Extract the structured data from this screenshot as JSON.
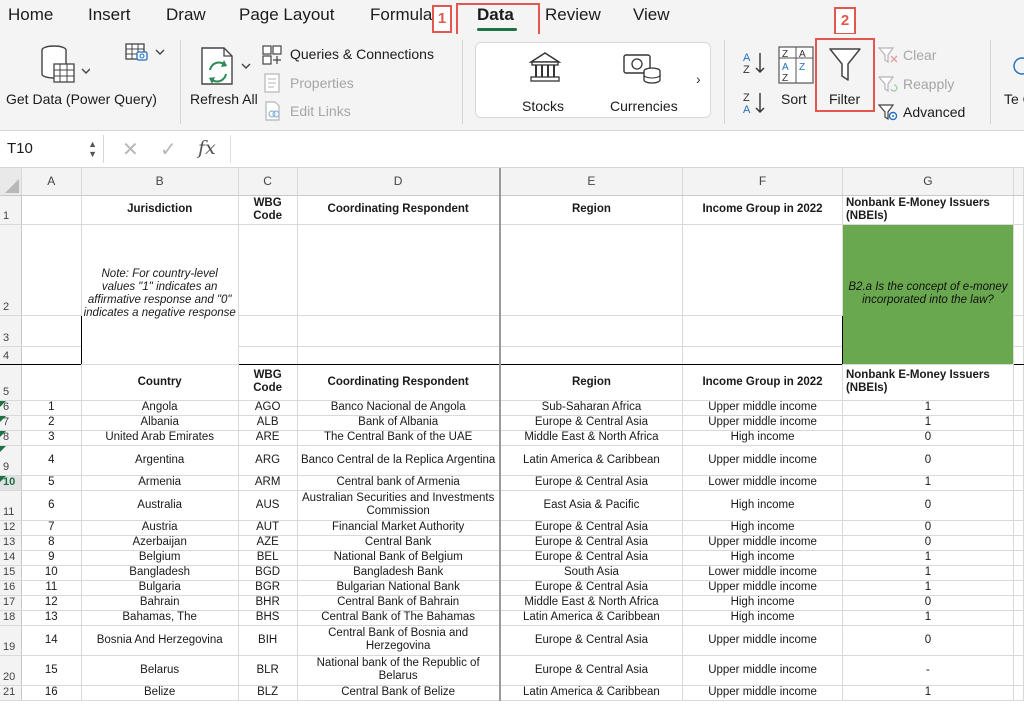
{
  "tabs": [
    {
      "label": "Home"
    },
    {
      "label": "Insert"
    },
    {
      "label": "Draw"
    },
    {
      "label": "Page Layout"
    },
    {
      "label": "Formulas"
    },
    {
      "label": "Data"
    },
    {
      "label": "Review"
    },
    {
      "label": "View"
    }
  ],
  "callouts": {
    "one": "1",
    "two": "2"
  },
  "ribbon": {
    "get_data": "Get Data (Power Query)",
    "refresh_all": "Refresh All",
    "queries_connections": "Queries & Connections",
    "properties": "Properties",
    "edit_links": "Edit Links",
    "stocks": "Stocks",
    "currencies": "Currencies",
    "sort": "Sort",
    "filter": "Filter",
    "clear": "Clear",
    "reapply": "Reapply",
    "advanced": "Advanced",
    "text_to_columns_partial": "Te Co"
  },
  "formula_bar": {
    "name_box": "T10",
    "cancel": "✕",
    "enter": "✓",
    "fx": "fx",
    "value": ""
  },
  "colors": {
    "accent": "#1e7145",
    "callout": "#e4574c",
    "highlight": "#6aa84f"
  },
  "sheet": {
    "columns": [
      "A",
      "B",
      "C",
      "D",
      "E",
      "F",
      "G"
    ],
    "header1": {
      "b": "Jurisdiction",
      "c": "WBG Code",
      "d": "Coordinating Respondent",
      "e": "Region",
      "f": "Income Group in 2022",
      "g": "Nonbank E-Money Issuers (NBEIs)"
    },
    "note": "Note: For country-level values \"1\" indicates an affirmative response and \"0\" indicates a negative response",
    "question": "B2.a Is the concept of e-money incorporated into the law?",
    "header5": {
      "b": "Country",
      "c": "WBG Code",
      "d": "Coordinating Respondent",
      "e": "Region",
      "f": "Income Group in 2022",
      "g": "Nonbank E-Money Issuers (NBEIs)"
    },
    "row_numbers": [
      "1",
      "2",
      "3",
      "4",
      "5"
    ],
    "rows": [
      {
        "r": "6",
        "a": "1",
        "b": "Angola",
        "c": "AGO",
        "d": "Banco Nacional de Angola",
        "e": "Sub-Saharan Africa",
        "f": "Upper middle income",
        "g": "1"
      },
      {
        "r": "7",
        "a": "2",
        "b": "Albania",
        "c": "ALB",
        "d": "Bank of Albania",
        "e": "Europe & Central Asia",
        "f": "Upper middle income",
        "g": "1"
      },
      {
        "r": "8",
        "a": "3",
        "b": "United Arab Emirates",
        "c": "ARE",
        "d": "The Central Bank of the UAE",
        "e": "Middle East & North Africa",
        "f": "High income",
        "g": "0"
      },
      {
        "r": "9",
        "a": "4",
        "b": "Argentina",
        "c": "ARG",
        "d": "Banco Central de la Replica Argentina",
        "e": "Latin America & Caribbean",
        "f": "Upper middle income",
        "g": "0"
      },
      {
        "r": "10",
        "a": "5",
        "b": "Armenia",
        "c": "ARM",
        "d": "Central bank of Armenia",
        "e": "Europe & Central Asia",
        "f": "Lower middle income",
        "g": "1"
      },
      {
        "r": "11",
        "a": "6",
        "b": "Australia",
        "c": "AUS",
        "d": "Australian Securities and Investments Commission",
        "e": "East Asia & Pacific",
        "f": "High income",
        "g": "0"
      },
      {
        "r": "12",
        "a": "7",
        "b": "Austria",
        "c": "AUT",
        "d": "Financial Market Authority",
        "e": "Europe & Central Asia",
        "f": "High income",
        "g": "0"
      },
      {
        "r": "13",
        "a": "8",
        "b": "Azerbaijan",
        "c": "AZE",
        "d": "Central Bank",
        "e": "Europe & Central Asia",
        "f": "Upper middle income",
        "g": "0"
      },
      {
        "r": "14",
        "a": "9",
        "b": "Belgium",
        "c": "BEL",
        "d": "National Bank of Belgium",
        "e": "Europe & Central Asia",
        "f": "High income",
        "g": "1"
      },
      {
        "r": "15",
        "a": "10",
        "b": "Bangladesh",
        "c": "BGD",
        "d": "Bangladesh Bank",
        "e": "South Asia",
        "f": "Lower middle income",
        "g": "1"
      },
      {
        "r": "16",
        "a": "11",
        "b": "Bulgaria",
        "c": "BGR",
        "d": "Bulgarian National Bank",
        "e": "Europe & Central Asia",
        "f": "Upper middle income",
        "g": "1"
      },
      {
        "r": "17",
        "a": "12",
        "b": "Bahrain",
        "c": "BHR",
        "d": "Central Bank of Bahrain",
        "e": "Middle East & North Africa",
        "f": "High income",
        "g": "0"
      },
      {
        "r": "18",
        "a": "13",
        "b": "Bahamas, The",
        "c": "BHS",
        "d": "Central Bank of The Bahamas",
        "e": "Latin America & Caribbean",
        "f": "High income",
        "g": "1"
      },
      {
        "r": "19",
        "a": "14",
        "b": "Bosnia And Herzegovina",
        "c": "BIH",
        "d": "Central Bank of Bosnia and Herzegovina",
        "e": "Europe & Central Asia",
        "f": "Upper middle income",
        "g": "0"
      },
      {
        "r": "20",
        "a": "15",
        "b": "Belarus",
        "c": "BLR",
        "d": "National bank of the Republic of Belarus",
        "e": "Europe & Central Asia",
        "f": "Upper middle income",
        "g": "-"
      },
      {
        "r": "21",
        "a": "16",
        "b": "Belize",
        "c": "BLZ",
        "d": "Central Bank of Belize",
        "e": "Latin America & Caribbean",
        "f": "Upper middle income",
        "g": "1"
      }
    ]
  }
}
